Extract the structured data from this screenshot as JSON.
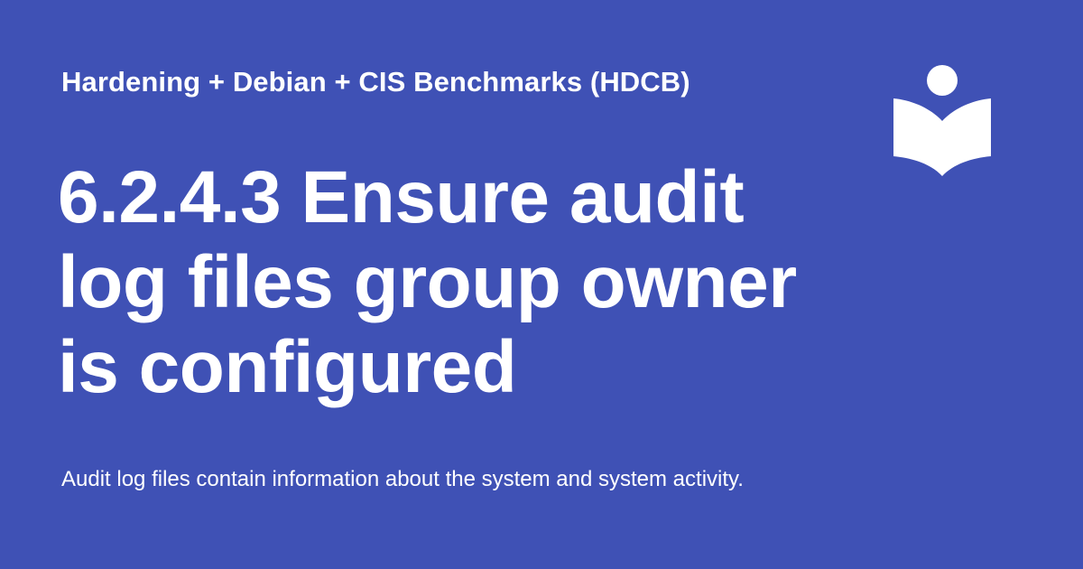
{
  "header": {
    "site_name": "Hardening + Debian + CIS Benchmarks (HDCB)",
    "logo_icon": "reader-book-icon"
  },
  "main": {
    "title": "6.2.4.3 Ensure audit log files group owner is configured",
    "description": "Audit log files contain information about the system and system activity."
  },
  "colors": {
    "background": "#3f51b5",
    "text": "#ffffff"
  }
}
